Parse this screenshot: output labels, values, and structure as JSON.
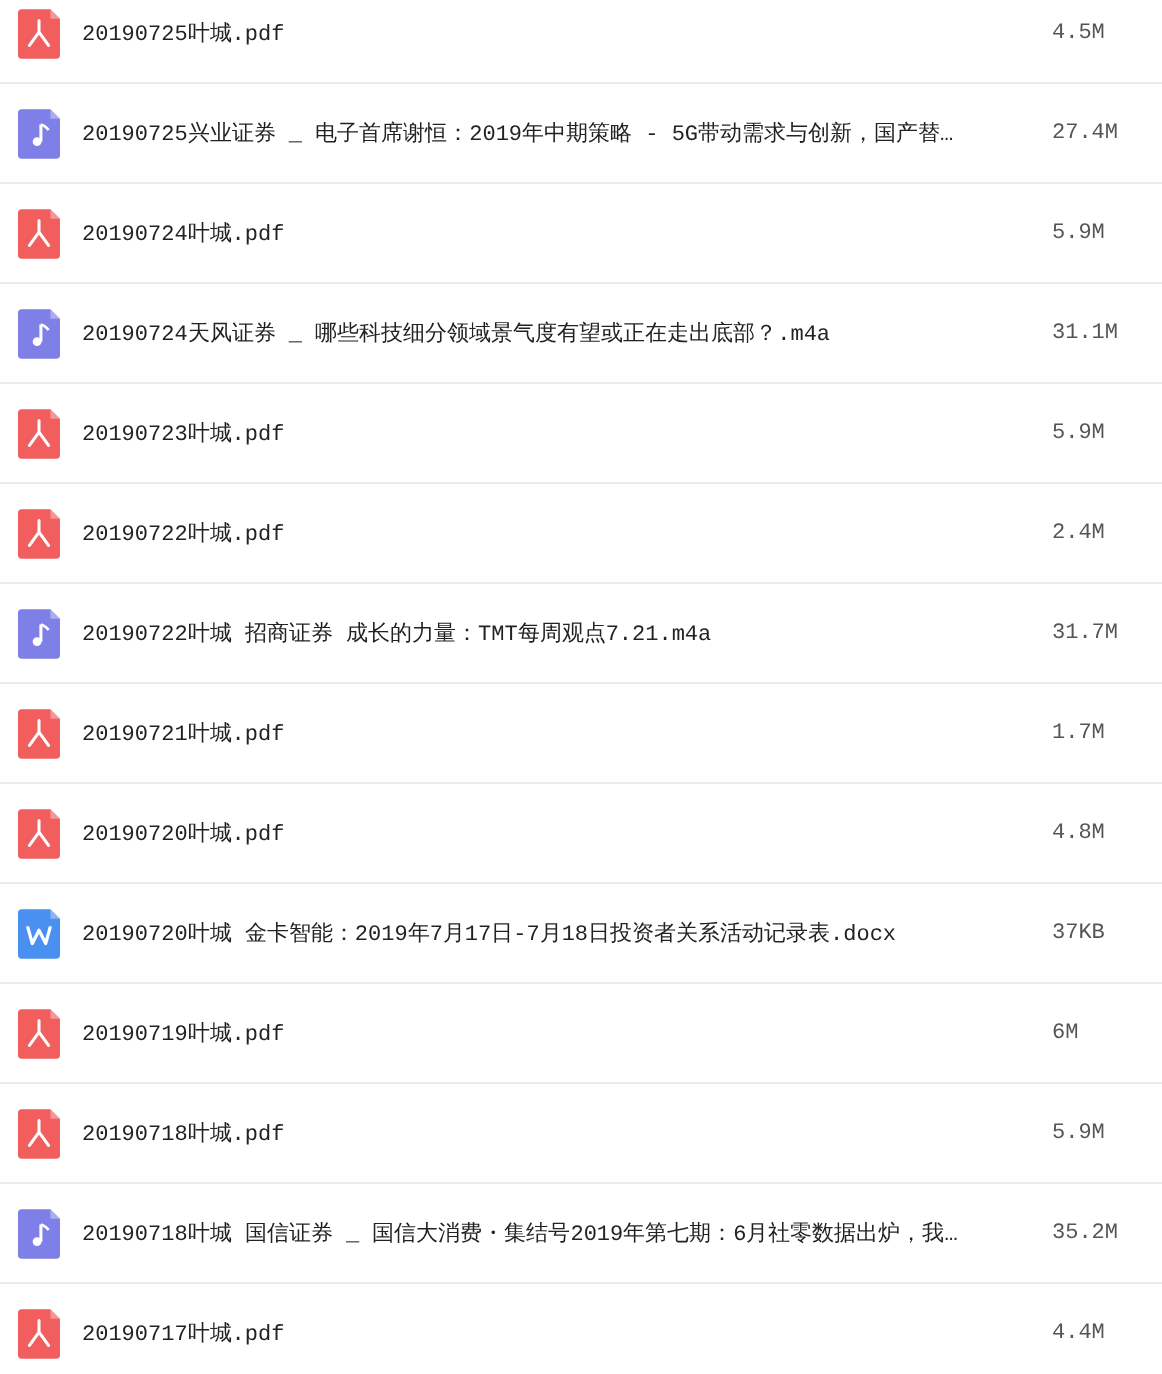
{
  "files": [
    {
      "kind": "pdf",
      "name": "20190725叶城.pdf",
      "size": "4.5M"
    },
    {
      "kind": "audio",
      "name": "20190725兴业证券 _ 电子首席谢恒：2019年中期策略 - 5G带动需求与创新，国产替…",
      "size": "27.4M"
    },
    {
      "kind": "pdf",
      "name": "20190724叶城.pdf",
      "size": "5.9M"
    },
    {
      "kind": "audio",
      "name": "20190724天风证券 _ 哪些科技细分领域景气度有望或正在走出底部？.m4a",
      "size": "31.1M"
    },
    {
      "kind": "pdf",
      "name": "20190723叶城.pdf",
      "size": "5.9M"
    },
    {
      "kind": "pdf",
      "name": "20190722叶城.pdf",
      "size": "2.4M"
    },
    {
      "kind": "audio",
      "name": "20190722叶城 招商证券 成长的力量：TMT每周观点7.21.m4a",
      "size": "31.7M"
    },
    {
      "kind": "pdf",
      "name": "20190721叶城.pdf",
      "size": "1.7M"
    },
    {
      "kind": "pdf",
      "name": "20190720叶城.pdf",
      "size": "4.8M"
    },
    {
      "kind": "word",
      "name": "20190720叶城 金卡智能：2019年7月17日-7月18日投资者关系活动记录表.docx",
      "size": "37KB"
    },
    {
      "kind": "pdf",
      "name": "20190719叶城.pdf",
      "size": "6M"
    },
    {
      "kind": "pdf",
      "name": "20190718叶城.pdf",
      "size": "5.9M"
    },
    {
      "kind": "audio",
      "name": "20190718叶城 国信证券 _ 国信大消费・集结号2019年第七期：6月社零数据出炉，我…",
      "size": "35.2M"
    },
    {
      "kind": "pdf",
      "name": "20190717叶城.pdf",
      "size": "4.4M"
    }
  ]
}
